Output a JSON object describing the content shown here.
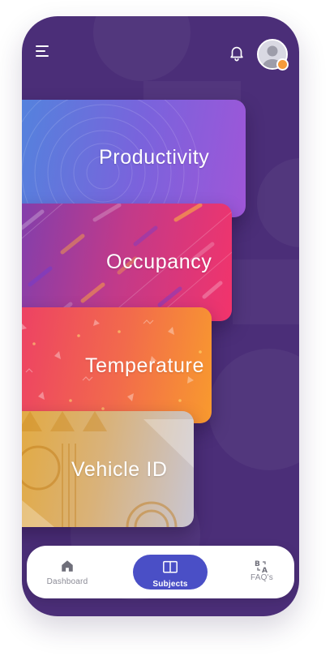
{
  "header": {
    "menu_icon": "hamburger-menu-icon",
    "notification_icon": "bell-icon",
    "avatar_icon": "user-avatar-icon",
    "avatar_badge_color": "#f59a3a"
  },
  "subjects": {
    "cards": [
      {
        "label": "Productivity",
        "gradient": [
          "#4f86dd",
          "#9f56d8"
        ]
      },
      {
        "label": "Occupancy",
        "gradient": [
          "#7a3fb0",
          "#f2346b"
        ]
      },
      {
        "label": "Temperature",
        "gradient": [
          "#ec3c67",
          "#f89a2e"
        ]
      },
      {
        "label": "Vehicle ID",
        "gradient": [
          "#e4a93a",
          "#c9c6d2"
        ]
      }
    ]
  },
  "bottom_nav": {
    "items": [
      {
        "label": "Dashboard",
        "icon": "home-icon",
        "active": false
      },
      {
        "label": "Subjects",
        "icon": "book-icon",
        "active": true
      },
      {
        "label": "FAQ's",
        "icon": "faq-translate-icon",
        "active": false
      }
    ],
    "active_color": "#4a4fc6"
  },
  "colors": {
    "background": "#4b2e78",
    "nav_background": "#ffffff"
  }
}
